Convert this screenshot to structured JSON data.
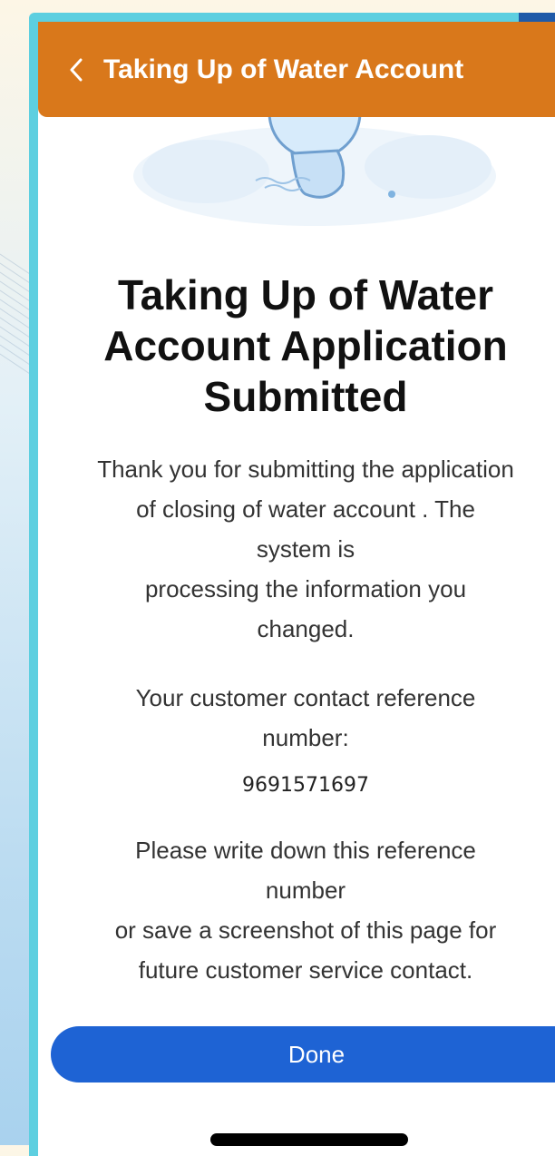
{
  "header": {
    "title": "Taking Up of Water Account",
    "back_icon": "chevron-left-icon"
  },
  "colors": {
    "header_bg": "#d9781b",
    "button_bg": "#1e63d4",
    "frame_accent": "#5dcfe0"
  },
  "hero": {
    "icon": "water-droplet-mascot-icon"
  },
  "main": {
    "title_lines": [
      "Taking Up of Water",
      "Account Application",
      "Submitted"
    ],
    "message_lines": [
      "Thank you for submitting the application",
      "of closing of water account . The",
      "system is",
      "processing the information you",
      "changed."
    ],
    "reference_lines": [
      "Your customer contact reference",
      "number:"
    ],
    "reference_number": "9691571697",
    "note_lines": [
      "Please write down this reference",
      "number",
      "or save a screenshot of this page for",
      "future customer service contact."
    ]
  },
  "actions": {
    "done_label": "Done"
  }
}
